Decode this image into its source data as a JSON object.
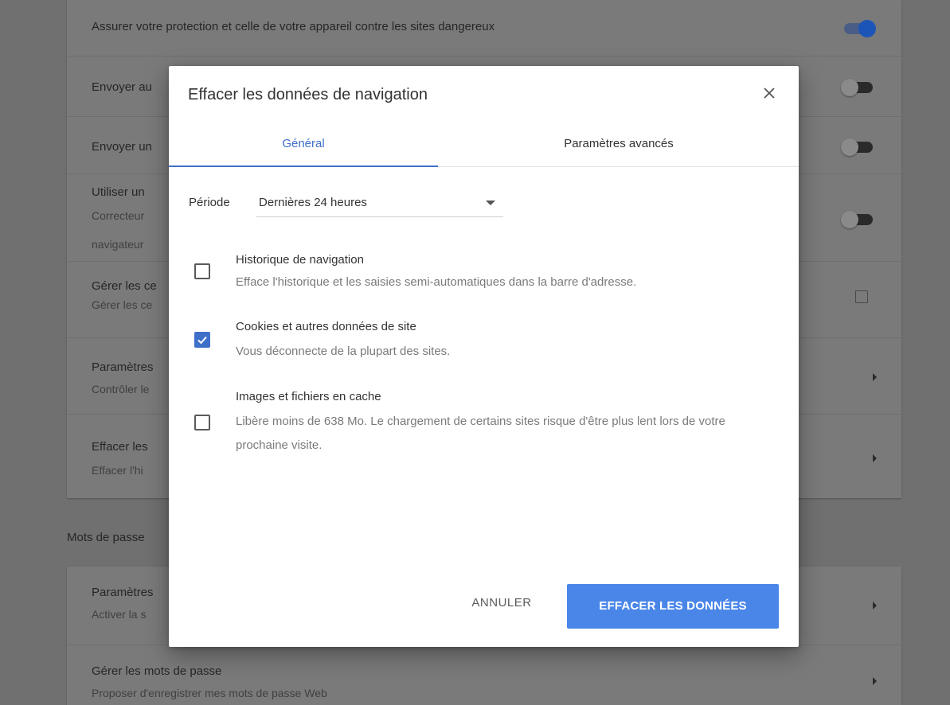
{
  "background": {
    "top_row": "Assurer votre protection et celle de votre appareil contre les sites dangereux",
    "rows": [
      {
        "title": "Envoyer au"
      },
      {
        "title": "Envoyer un"
      },
      {
        "title": "Utiliser un",
        "sub1": "Correcteur",
        "sub2": "navigateur"
      },
      {
        "title": "Gérer les ce",
        "sub1": "Gérer les ce"
      },
      {
        "title": "Paramètres",
        "sub1": "Contrôler le"
      },
      {
        "title": "Effacer les",
        "sub1": "Effacer l'hi"
      }
    ],
    "section_title": "Mots de passe",
    "password_rows": [
      {
        "title": "Paramètres",
        "sub1": "Activer la s"
      },
      {
        "title": "Gérer les mots de passe",
        "sub1": "Proposer d'enregistrer mes mots de passe Web"
      }
    ]
  },
  "dialog": {
    "title": "Effacer les données de navigation",
    "close_icon": "close-icon",
    "tabs": [
      {
        "label": "Général",
        "active": true
      },
      {
        "label": "Paramètres avancés",
        "active": false
      }
    ],
    "period": {
      "label": "Période",
      "value": "Dernières 24 heures"
    },
    "options": [
      {
        "title": "Historique de navigation",
        "description": "Efface l'historique et les saisies semi-automatiques dans la barre d'adresse.",
        "checked": false
      },
      {
        "title": "Cookies et autres données de site",
        "description": "Vous déconnecte de la plupart des sites.",
        "checked": true
      },
      {
        "title": "Images et fichiers en cache",
        "description": "Libère moins de 638 Mo. Le chargement de certains sites risque d'être plus lent lors de votre prochaine visite.",
        "checked": false
      }
    ],
    "cancel_label": "ANNULER",
    "confirm_label": "EFFACER LES DONNÉES"
  },
  "colors": {
    "accent": "#4a86e8",
    "tab_active": "#3f70c8"
  }
}
